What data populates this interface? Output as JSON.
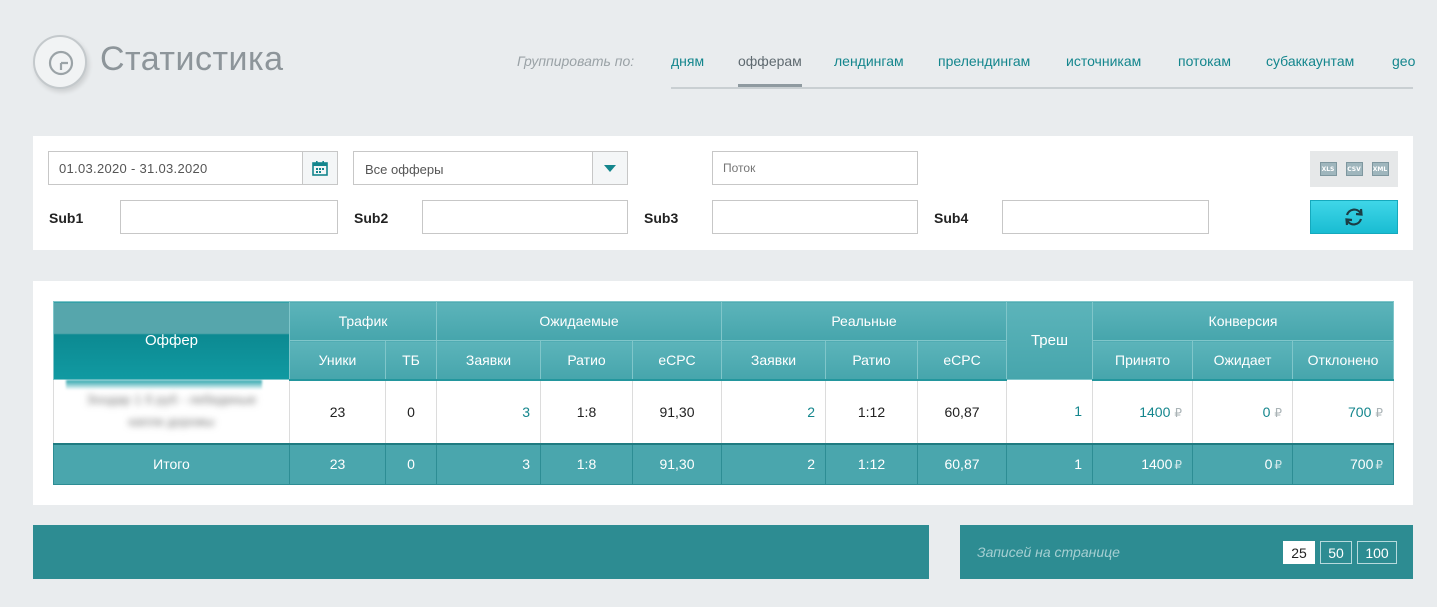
{
  "header": {
    "title": "Статистика",
    "logo_icon": "stats-logo-icon"
  },
  "grouping": {
    "label": "Группировать по:",
    "tabs": [
      {
        "label": "дням",
        "active": false
      },
      {
        "label": "офферам",
        "active": true
      },
      {
        "label": "лендингам",
        "active": false
      },
      {
        "label": "прелендингам",
        "active": false
      },
      {
        "label": "источникам",
        "active": false
      },
      {
        "label": "потокам",
        "active": false
      },
      {
        "label": "субаккаунтам",
        "active": false
      },
      {
        "label": "geo",
        "active": false
      }
    ]
  },
  "filters": {
    "date_range": "01.03.2020 - 31.03.2020",
    "offer_select": "Все офферы",
    "stream_placeholder": "Поток",
    "sub1_label": "Sub1",
    "sub2_label": "Sub2",
    "sub3_label": "Sub3",
    "sub4_label": "Sub4",
    "sub1_value": "",
    "sub2_value": "",
    "sub3_value": "",
    "sub4_value": "",
    "export": [
      "XLS",
      "CSV",
      "XML"
    ]
  },
  "table": {
    "headers": {
      "offer": "Оффер",
      "traffic": "Трафик",
      "expected": "Ожидаемые",
      "real": "Реальные",
      "tresh": "Треш",
      "conversion": "Конверсия",
      "uniques": "Уники",
      "tb": "ТБ",
      "exp_requests": "Заявки",
      "exp_ratio": "Ратио",
      "exp_ecpc": "eCPC",
      "real_requests": "Заявки",
      "real_ratio": "Ратио",
      "real_ecpc": "eCPC",
      "accepted": "Принято",
      "pending": "Ожидает",
      "rejected": "Отклонено"
    },
    "rows": [
      {
        "offer_line1": "Зоодар 1 б руб - лебединые",
        "offer_line2": "капли дорожы",
        "uniques": "23",
        "tb": "0",
        "exp_requests": "3",
        "exp_ratio": "1:8",
        "exp_ecpc": "91,30",
        "real_requests": "2",
        "real_ratio": "1:12",
        "real_ecpc": "60,87",
        "tresh": "1",
        "accepted": "1400",
        "pending": "0",
        "rejected": "700"
      }
    ],
    "currency": "₽",
    "total": {
      "label": "Итого",
      "uniques": "23",
      "tb": "0",
      "exp_requests": "3",
      "exp_ratio": "1:8",
      "exp_ecpc": "91,30",
      "real_requests": "2",
      "real_ratio": "1:12",
      "real_ecpc": "60,87",
      "tresh": "1",
      "accepted": "1400",
      "pending": "0",
      "rejected": "700"
    }
  },
  "pagination": {
    "per_page_label": "Записей на странице",
    "options": [
      "25",
      "50",
      "100"
    ],
    "selected": "25"
  }
}
